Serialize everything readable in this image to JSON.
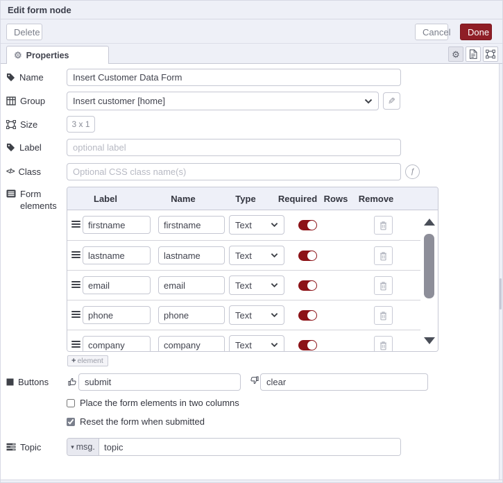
{
  "window": {
    "title": "Edit form node"
  },
  "toolbar": {
    "delete": "Delete",
    "cancel": "Cancel",
    "done": "Done"
  },
  "tabbar": {
    "properties": "Properties"
  },
  "fields": {
    "name": {
      "label": "Name",
      "value": "Insert Customer Data Form"
    },
    "group": {
      "label": "Group",
      "value": "Insert customer [home]"
    },
    "size": {
      "label": "Size",
      "value": "3 x 1"
    },
    "label": {
      "label": "Label",
      "placeholder": "optional label"
    },
    "class": {
      "label": "Class",
      "placeholder": "Optional CSS class name(s)"
    },
    "form_elements": {
      "label": "Form elements"
    },
    "buttons": {
      "label": "Buttons",
      "submit": "submit",
      "clear": "clear"
    },
    "topic": {
      "label": "Topic",
      "prefix": "msg.",
      "value": "topic"
    }
  },
  "elements_table": {
    "headers": {
      "label": "Label",
      "name": "Name",
      "type": "Type",
      "required": "Required",
      "rows": "Rows",
      "remove": "Remove"
    },
    "rows": [
      {
        "label": "firstname",
        "name": "firstname",
        "type": "Text",
        "required": true
      },
      {
        "label": "lastname",
        "name": "lastname",
        "type": "Text",
        "required": true
      },
      {
        "label": "email",
        "name": "email",
        "type": "Text",
        "required": true
      },
      {
        "label": "phone",
        "name": "phone",
        "type": "Text",
        "required": true
      },
      {
        "label": "company",
        "name": "company",
        "type": "Text",
        "required": true
      }
    ],
    "add_button": "element"
  },
  "options": [
    {
      "label": "Place the form elements in two columns",
      "checked": false
    },
    {
      "label": "Reset the form when submitted",
      "checked": true
    }
  ],
  "colors": {
    "chrome_bg": "#eef0f7",
    "accent_red": "#8f1e26",
    "toggle_red": "#8c1217"
  }
}
